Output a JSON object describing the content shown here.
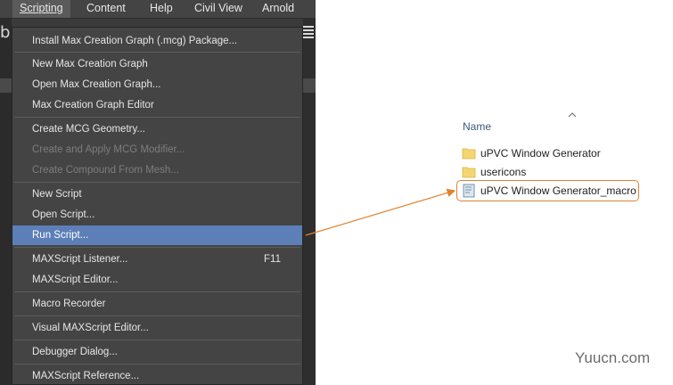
{
  "menubar": {
    "items": [
      "Scripting",
      "Content",
      "Help",
      "Civil View",
      "Arnold"
    ]
  },
  "menu": {
    "items": [
      {
        "label": "Install Max Creation Graph (.mcg) Package...",
        "state": "normal"
      },
      {
        "label": "New Max Creation Graph",
        "state": "normal"
      },
      {
        "label": "Open Max Creation Graph...",
        "state": "normal"
      },
      {
        "label": "Max Creation Graph Editor",
        "state": "normal"
      },
      {
        "label": "Create MCG Geometry...",
        "state": "normal"
      },
      {
        "label": "Create and Apply MCG Modifier...",
        "state": "disabled"
      },
      {
        "label": "Create Compound From Mesh...",
        "state": "disabled"
      },
      {
        "label": "New Script",
        "state": "normal"
      },
      {
        "label": "Open Script...",
        "state": "normal"
      },
      {
        "label": "Run Script...",
        "state": "highlighted"
      },
      {
        "label": "MAXScript Listener...",
        "state": "normal",
        "shortcut": "F11"
      },
      {
        "label": "MAXScript Editor...",
        "state": "normal"
      },
      {
        "label": "Macro Recorder",
        "state": "normal"
      },
      {
        "label": "Visual MAXScript Editor...",
        "state": "normal"
      },
      {
        "label": "Debugger Dialog...",
        "state": "normal"
      },
      {
        "label": "MAXScript Reference...",
        "state": "normal"
      }
    ]
  },
  "explorer": {
    "column_header": "Name",
    "files": [
      {
        "name": "uPVC Window Generator",
        "type": "folder"
      },
      {
        "name": "usericons",
        "type": "folder"
      },
      {
        "name": "uPVC Window Generator_macro",
        "type": "script",
        "highlighted": true
      }
    ]
  },
  "watermark": "Yuucn.com",
  "colors": {
    "menu_bg": "#444444",
    "menu_highlight": "#5d7fb8",
    "callout_orange": "#e0822f",
    "folder_yellow": "#f5d571"
  }
}
